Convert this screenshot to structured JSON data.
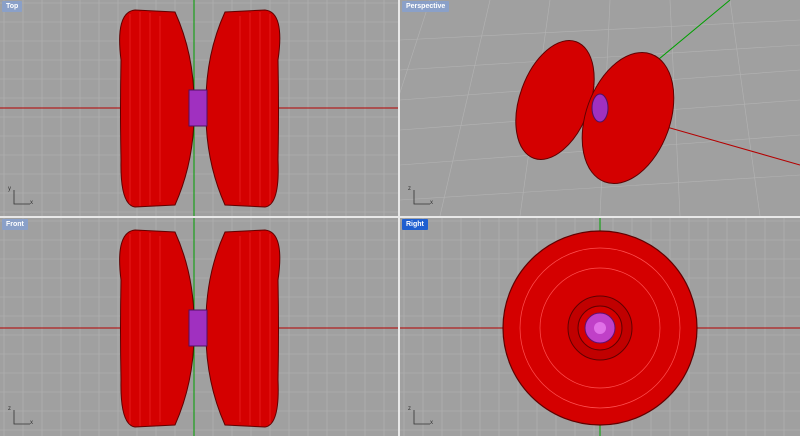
{
  "viewports": {
    "top": {
      "label": "Top",
      "active": false,
      "axes": [
        "y",
        "x"
      ]
    },
    "persp": {
      "label": "Perspective",
      "active": false,
      "axes": [
        "z",
        "x"
      ]
    },
    "front": {
      "label": "Front",
      "active": false,
      "axes": [
        "z",
        "x"
      ]
    },
    "right": {
      "label": "Right",
      "active": true,
      "axes": [
        "z",
        "x"
      ]
    }
  },
  "colors": {
    "background": "#a0a0a0",
    "grid": "#b3b3b3",
    "x_axis": "#b40000",
    "y_axis": "#00a000",
    "body_red": "#e00000",
    "bearing_purple": "#a030c0",
    "tab_active": "#1f5fd0",
    "tab_inactive": "#8aa0c8"
  }
}
